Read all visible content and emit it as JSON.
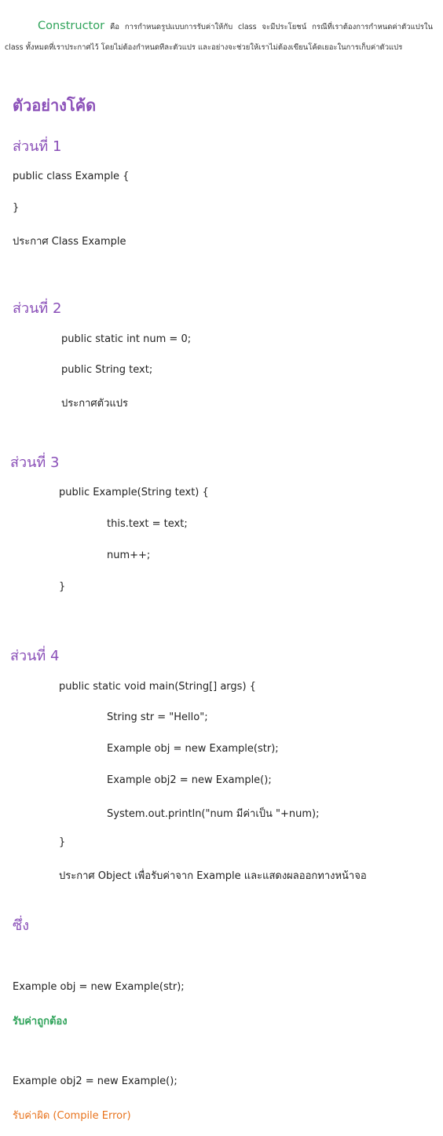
{
  "intro": {
    "keyword": "Constructor",
    "text": " คือ การกำหนดรูปแบบการรับค่าให้กับ class จะมีประโยชน์ กรณีที่เราต้องการกำหนดค่าตัวแปรใน class ทั้งหมดที่เราประกาศไว้ โดยไม่ต้องกำหนดทีละตัวแปร และอย่างจะช่วยให้เราไม่ต้องเขียนโค้ดเยอะในการเก็บค่าตัวแปร"
  },
  "heading": "ตัวอย่างโค้ด",
  "part1": {
    "title": "ส่วนที่ 1",
    "lines": [
      "public class Example {",
      "}"
    ],
    "note": "ประกาศ Class Example"
  },
  "part2": {
    "title": "ส่วนที่ 2",
    "lines": [
      "public static int num = 0;",
      "public String text;"
    ],
    "note": "ประกาศตัวแปร"
  },
  "part3": {
    "title": "ส่วนที่ 3",
    "lines": [
      "public Example(String text) {",
      "this.text = text;",
      "num++;",
      "}"
    ]
  },
  "part4": {
    "title": "ส่วนที่ 4",
    "lines": [
      "public static void main(String[] args)  {",
      "String str = \"Hello\";",
      "Example obj = new  Example(str);",
      "Example obj2 = new Example();",
      "System.out.println(\"num มีค่าเป็น \"+num);",
      "}"
    ],
    "note": "ประกาศ Object เพื่อรับค่าจาก Example และแสดงผลออกทางหน้าจอ"
  },
  "summary": {
    "title": "ซึ่ง",
    "example1": "Example obj = new  Example(str);",
    "result1": "รับค่าถูกต้อง",
    "example2": "Example obj2 = new Example();",
    "result2": "รับค่าผิด (Compile Error)"
  }
}
